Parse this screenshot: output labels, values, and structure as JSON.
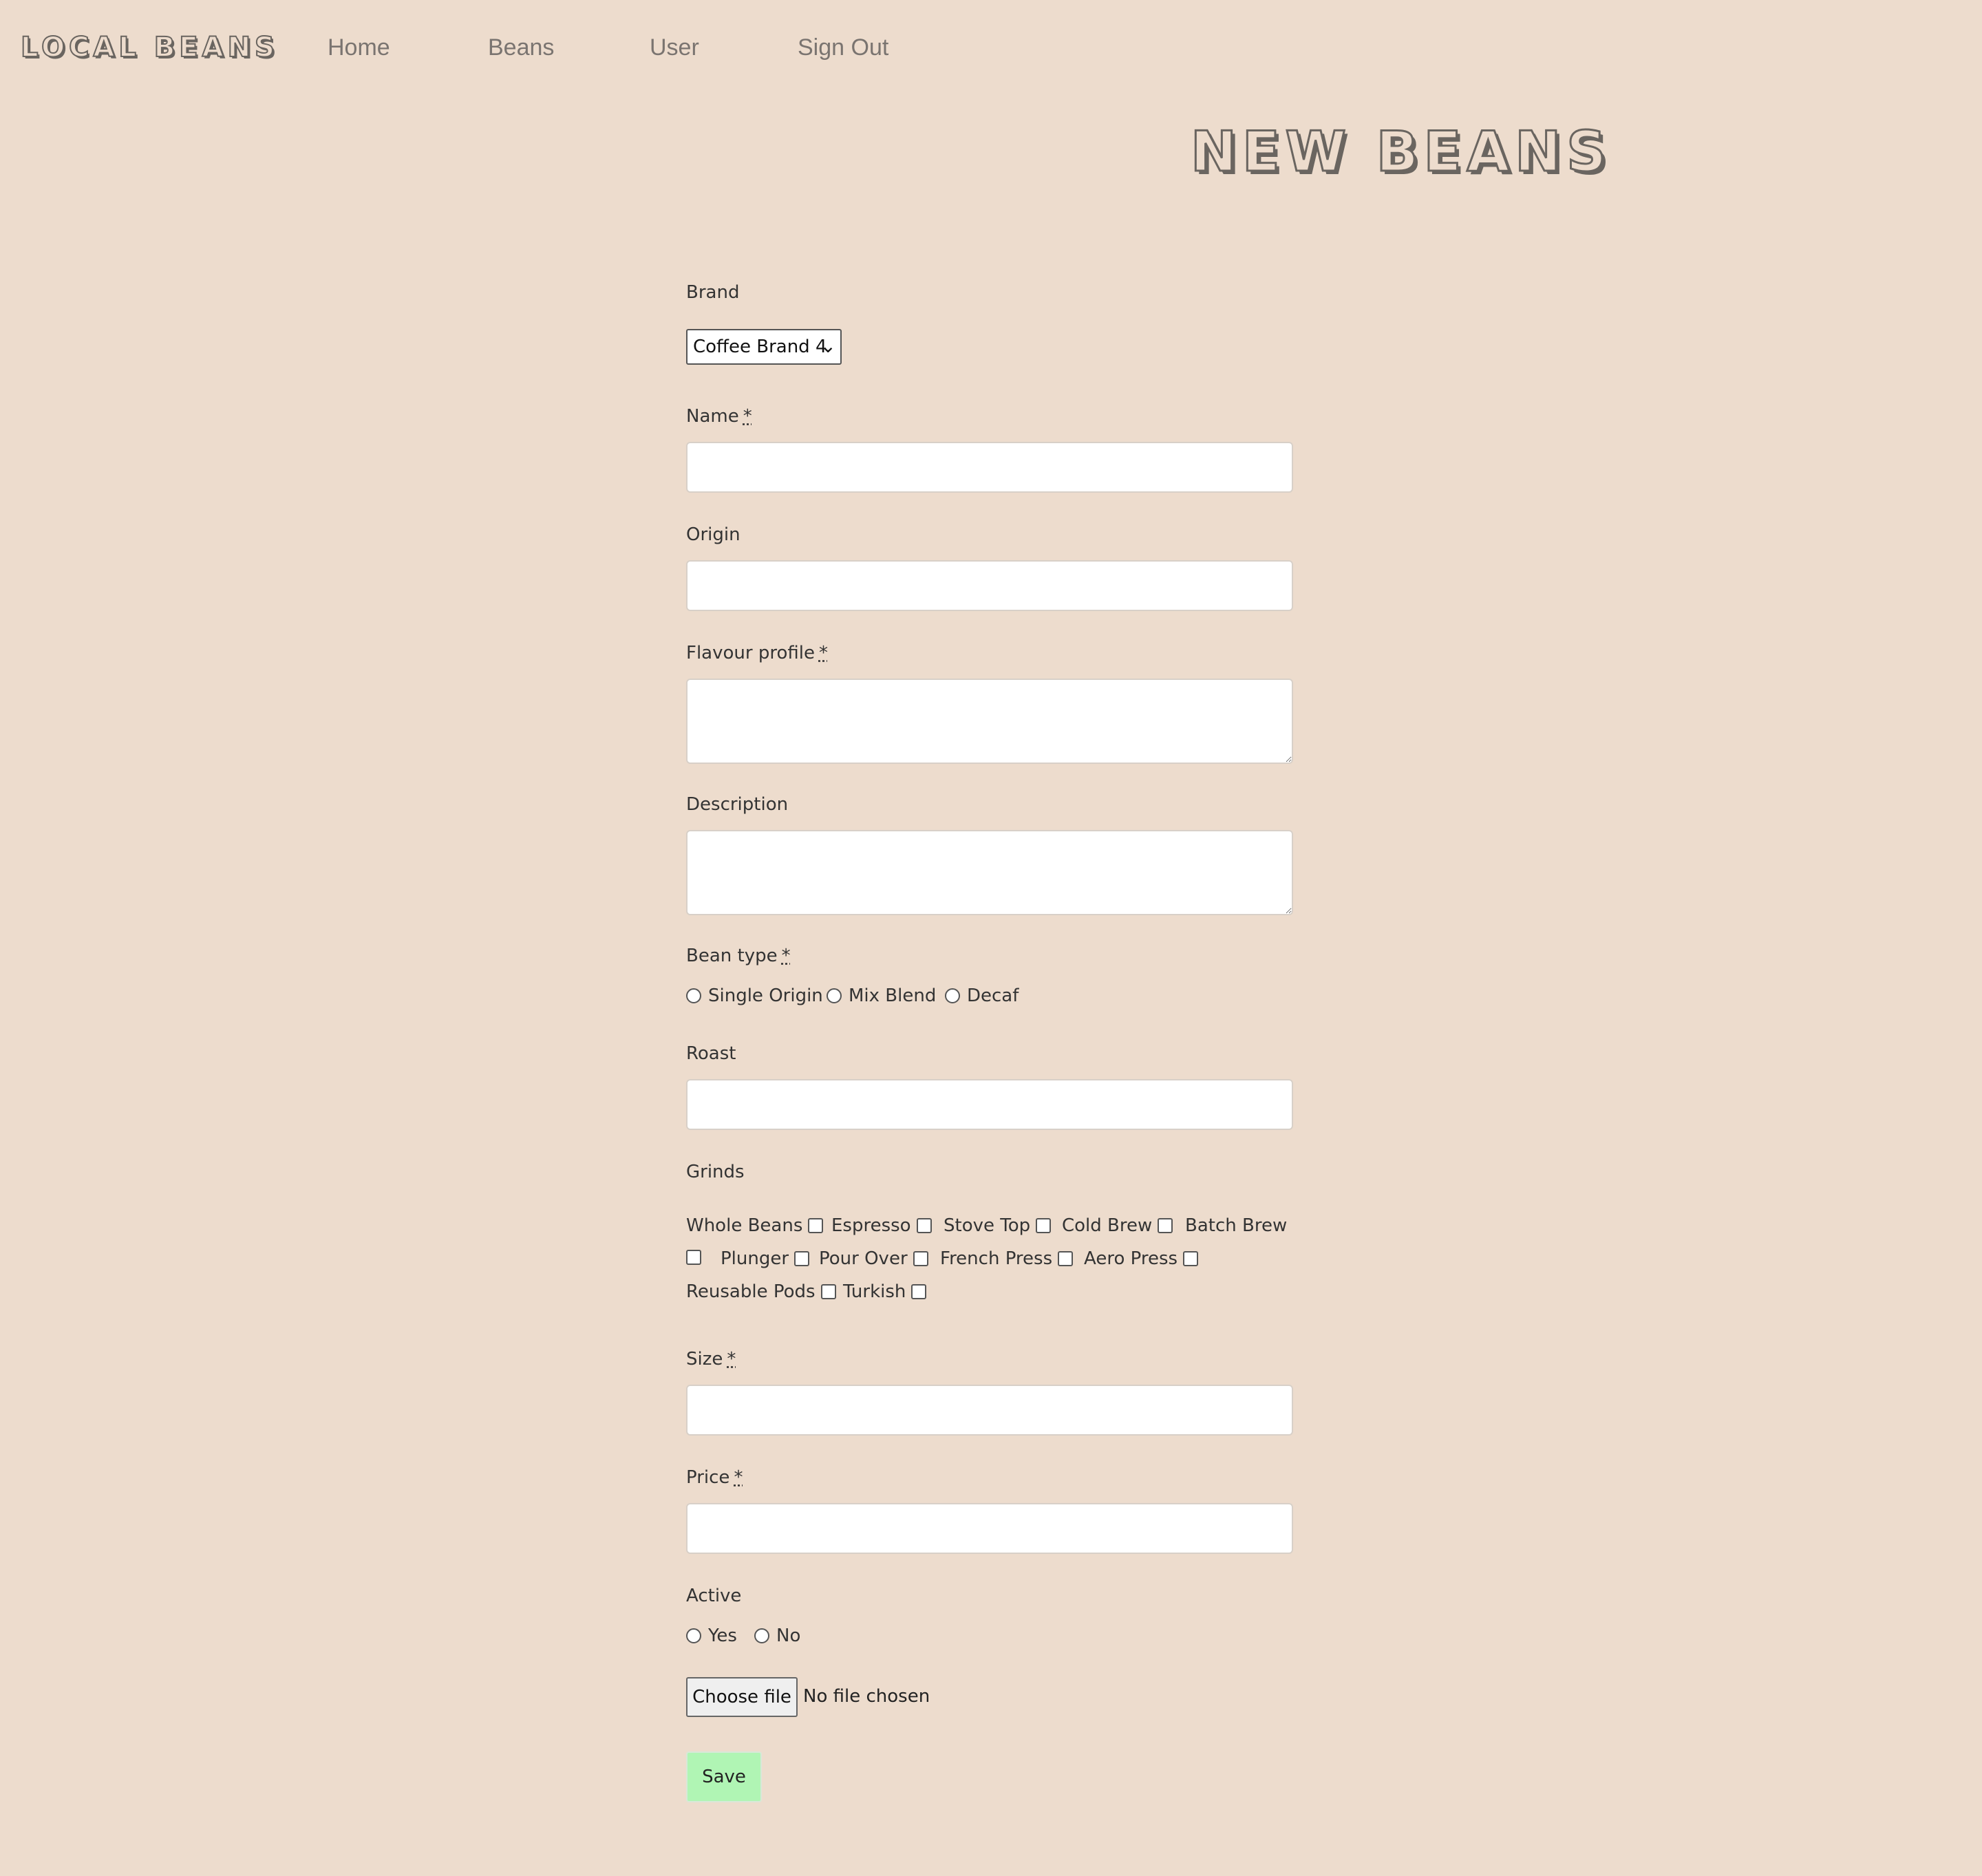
{
  "nav": {
    "logo": "LOCAL BEANS",
    "links": [
      "Home",
      "Beans",
      "User",
      "Sign Out"
    ]
  },
  "page_title": "NEW BEANS",
  "form": {
    "brand": {
      "label": "Brand",
      "selected": "Coffee Brand 4"
    },
    "name": {
      "label": "Name",
      "required_mark": "*",
      "value": ""
    },
    "origin": {
      "label": "Origin",
      "value": ""
    },
    "flavour_profile": {
      "label": "Flavour profile",
      "required_mark": "*",
      "value": ""
    },
    "description": {
      "label": "Description",
      "value": ""
    },
    "bean_type": {
      "label": "Bean type",
      "required_mark": "*",
      "options": [
        "Single Origin",
        "Mix Blend",
        "Decaf"
      ],
      "selected": null
    },
    "roast": {
      "label": "Roast",
      "value": ""
    },
    "grinds": {
      "label": "Grinds",
      "options": [
        "Whole Beans",
        "Espresso",
        "Stove Top",
        "Cold Brew",
        "Batch Brew",
        "Plunger",
        "Pour Over",
        "French Press",
        "Aero Press",
        "Reusable Pods",
        "Turkish"
      ],
      "checked": []
    },
    "size": {
      "label": "Size",
      "required_mark": "*",
      "value": ""
    },
    "price": {
      "label": "Price",
      "required_mark": "*",
      "value": ""
    },
    "active": {
      "label": "Active",
      "options": [
        "Yes",
        "No"
      ],
      "selected": null
    },
    "file": {
      "button": "Choose file",
      "status": "No file chosen"
    },
    "save": "Save"
  },
  "colors": {
    "background": "#eddccd",
    "save_button": "#b0f5b4",
    "outline_text": "#6a6560"
  }
}
